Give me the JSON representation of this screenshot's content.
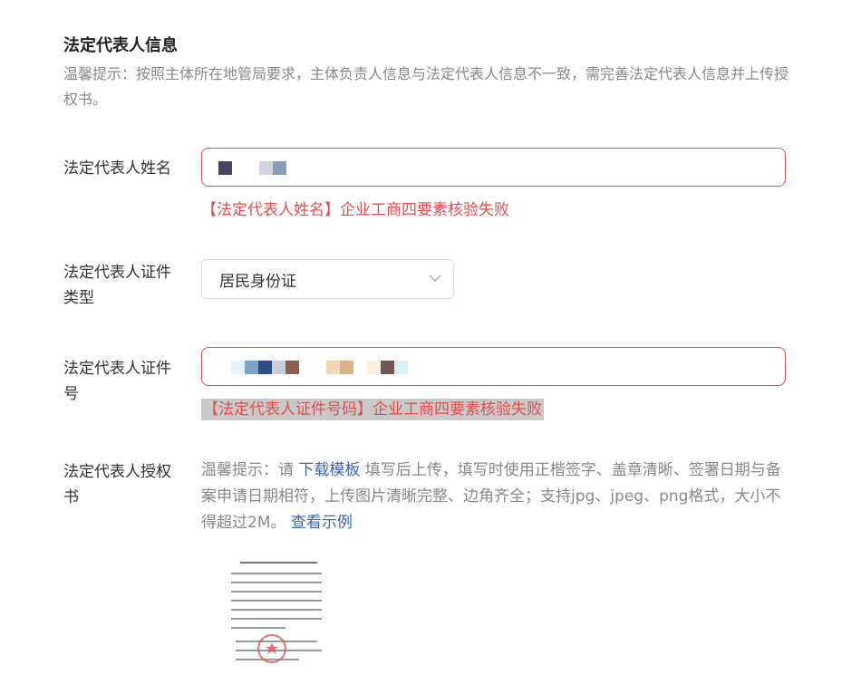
{
  "section": {
    "title": "法定代表人信息",
    "tip": "温馨提示：按照主体所在地管局要求，主体负责人信息与法定代表人信息不一致，需完善法定代表人信息并上传授权书。"
  },
  "fields": {
    "name": {
      "label": "法定代表人姓名",
      "error": "【法定代表人姓名】企业工商四要素核验失败"
    },
    "id_type": {
      "label": "法定代表人证件类型",
      "value": "居民身份证"
    },
    "id_number": {
      "label": "法定代表人证件号",
      "error": "【法定代表人证件号码】企业工商四要素核验失败"
    },
    "authorization": {
      "label": "法定代表人授权书",
      "tip_prefix": "温馨提示：请 ",
      "download_link": "下载模板",
      "tip_middle": " 填写后上传，填写时使用正楷签字、盖章清晰、签署日期与备案申请日期相符，上传图片清晰完整、边角齐全；支持jpg、jpeg、png格式，大小不得超过2M。 ",
      "example_link": "查看示例"
    }
  },
  "colors": {
    "error": "#e24f4f",
    "link": "#3e63b2",
    "muted": "#888888"
  }
}
